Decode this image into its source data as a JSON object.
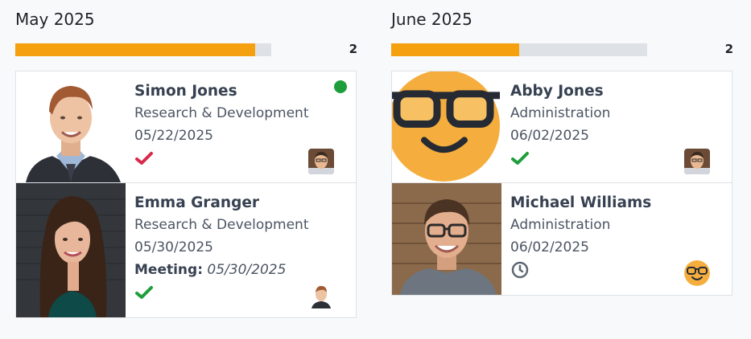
{
  "columns": [
    {
      "title": "May 2025",
      "count": "2",
      "progress": 0.938,
      "progress_color": "#f5a00e",
      "cards": [
        {
          "name": "Simon Jones",
          "department": "Research & Development",
          "date": "05/22/2025",
          "status_icon": "check-icon",
          "status_color": "#d9294a",
          "online": true,
          "avatar": "man-photo"
        },
        {
          "name": "Emma Granger",
          "department": "Research & Development",
          "date": "05/30/2025",
          "meeting_label": "Meeting:",
          "meeting_date": "05/30/2025",
          "status_icon": "check-icon",
          "status_color": "#1e9e3a",
          "avatar": "man-photo"
        }
      ]
    },
    {
      "title": "June 2025",
      "count": "2",
      "progress": 0.5,
      "progress_color": "#f5a00e",
      "cards": [
        {
          "name": "Abby Jones",
          "department": "Administration",
          "date": "06/02/2025",
          "status_icon": "check-icon",
          "status_color": "#1e9e3a",
          "avatar": "man-photo"
        },
        {
          "name": "Michael Williams",
          "department": "Administration",
          "date": "06/02/2025",
          "status_icon": "clock-icon",
          "status_color": "#5f6773",
          "avatar": "smiley-glasses"
        }
      ]
    }
  ]
}
